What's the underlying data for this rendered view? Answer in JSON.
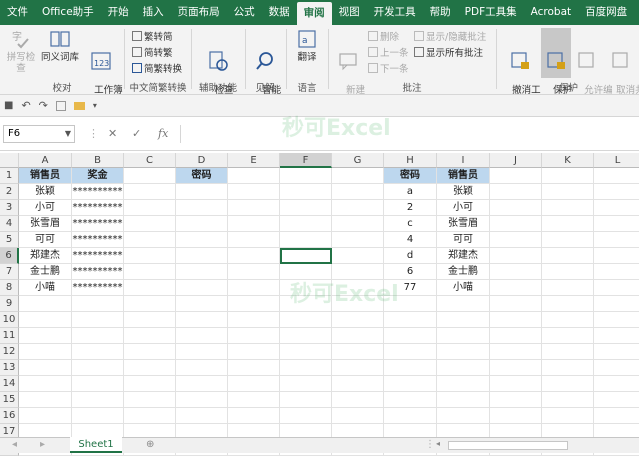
{
  "tabs": [
    "文件",
    "Office助手",
    "开始",
    "插入",
    "页面布局",
    "公式",
    "数据",
    "审阅",
    "视图",
    "开发工具",
    "帮助",
    "PDF工具集",
    "Acrobat",
    "百度网盘"
  ],
  "active_tab": "审阅",
  "ribbon": {
    "spell": "拼写检查",
    "thesaurus": "同义词库",
    "stats": "工作簿\n统计信息",
    "g_proof": "校对",
    "trad": "繁转简",
    "simp": "简转繁",
    "conv": "简繁转换",
    "g_chinese": "中文简繁转换",
    "access_check": "检查\n辅助功能",
    "g_access": "辅助功能",
    "smart": "智能\n查找",
    "g_insight": "见解",
    "translate": "翻译",
    "g_lang": "语言",
    "new_comment": "新建\n批注",
    "delete": "删除",
    "prev": "上一条",
    "next": "下一条",
    "show_hide": "显示/隐藏批注",
    "show_all": "显示所有批注",
    "g_comments": "批注",
    "unshare": "撤消工\n作表保护",
    "protect_wb": "保护\n工作簿",
    "allow_edit": "允许编\n辑区域",
    "unshare_wb": "取消共\n享工作簿",
    "g_protect": "保护"
  },
  "qat": {
    "save": "💾",
    "undo": "↶",
    "redo": "↷"
  },
  "formula_bar": {
    "namebox": "F6",
    "cancel": "✕",
    "enter": "✓",
    "fx": "fx",
    "value": ""
  },
  "columns": [
    "A",
    "B",
    "C",
    "D",
    "E",
    "F",
    "G",
    "H",
    "I",
    "J",
    "K",
    "L"
  ],
  "rows": [
    "1",
    "2",
    "3",
    "4",
    "5",
    "6",
    "7",
    "8",
    "9",
    "10",
    "11",
    "12",
    "13",
    "14",
    "15",
    "16",
    "17",
    "18"
  ],
  "table_a": {
    "h1": "销售员",
    "h2": "奖金",
    "names": [
      "张颖",
      "小可",
      "张雪眉",
      "可可",
      "郑建杰",
      "金士鹏",
      "小喵"
    ],
    "mask": "**********"
  },
  "d_header": "密码",
  "table_h": {
    "h1": "密码",
    "h2": "销售员",
    "codes": [
      "a",
      "2",
      "c",
      "4",
      "d",
      "6",
      "77"
    ],
    "names": [
      "张颖",
      "小可",
      "张雪眉",
      "可可",
      "郑建杰",
      "金士鹏",
      "小喵"
    ]
  },
  "watermark": "秒可Excel",
  "sheet_tab": "Sheet1",
  "add_sheet": "⊕"
}
